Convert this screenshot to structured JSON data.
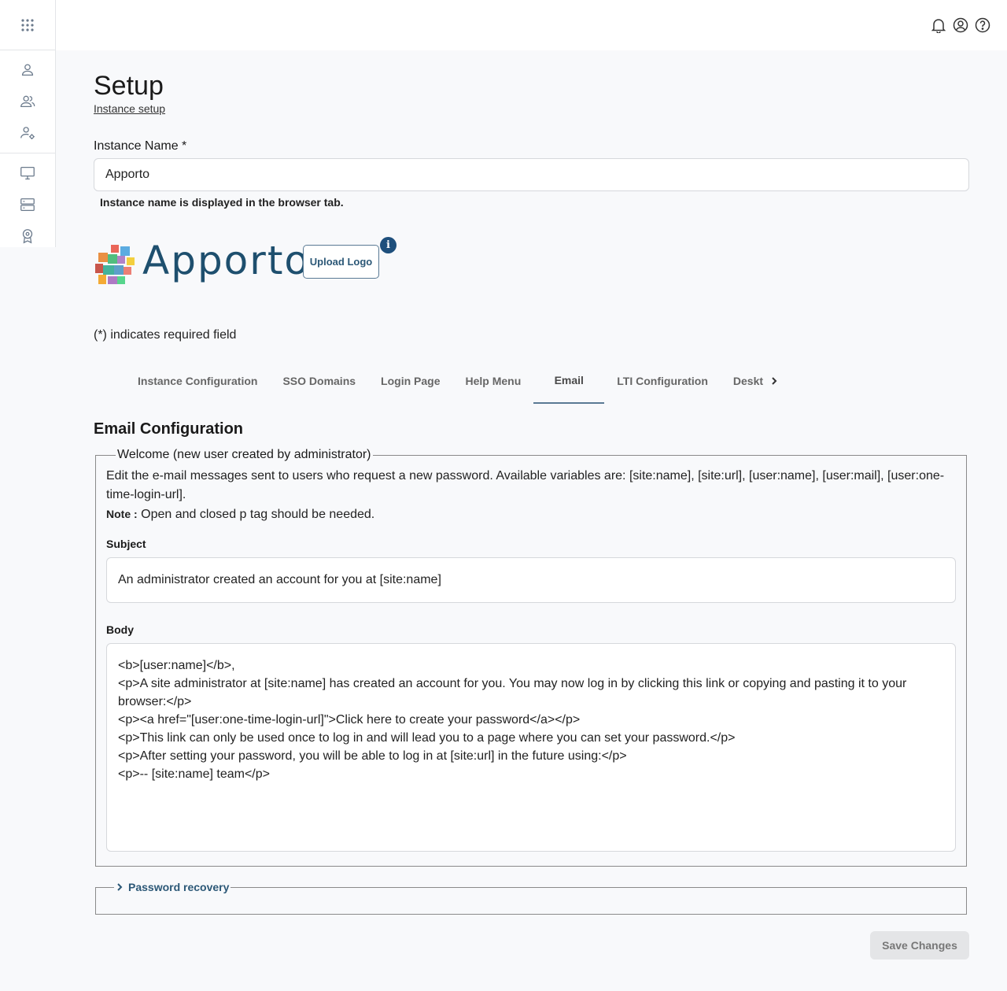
{
  "page": {
    "title": "Setup",
    "breadcrumb": "Instance setup"
  },
  "instance": {
    "label": "Instance Name *",
    "value": "Apporto",
    "helper": "Instance name is displayed in the browser tab."
  },
  "logo": {
    "text": "Apporto",
    "upload_label": "Upload Logo",
    "info_glyph": "i"
  },
  "required_note": "(*) indicates required field",
  "tabs": [
    {
      "label": "Instance Configuration"
    },
    {
      "label": "SSO Domains"
    },
    {
      "label": "Login Page"
    },
    {
      "label": "Help Menu"
    },
    {
      "label": "Email"
    },
    {
      "label": "LTI Configuration"
    },
    {
      "label": "Deskt"
    }
  ],
  "active_tab": "Email",
  "email": {
    "section_title": "Email Configuration",
    "welcome": {
      "legend": "Welcome (new user created by administrator)",
      "description": "Edit the e-mail messages sent to users who request a new password. Available variables are: [site:name], [site:url], [user:name], [user:mail], [user:one-time-login-url].",
      "note_label": "Note :",
      "note_text": " Open and closed p tag should be needed.",
      "subject_label": "Subject",
      "subject_value": "An administrator created an account for you at [site:name]",
      "body_label": "Body",
      "body_value": "<b>[user:name]</b>,\n<p>A site administrator at [site:name] has created an account for you. You may now log in by clicking this link or copying and pasting it to your browser:</p>\n<p><a href=\"[user:one-time-login-url]\">Click here to create your password</a></p>\n<p>This link can only be used once to log in and will lead you to a page where you can set your password.</p>\n<p>After setting your password, you will be able to log in at [site:url] in the future using:</p>\n<p>-- [site:name] team</p>"
    },
    "password_recovery": {
      "legend": "Password recovery"
    }
  },
  "save_label": "Save Changes",
  "colors": {
    "brand": "#1e4f6e",
    "accent": "#2c5877",
    "background": "#f8f9fb"
  },
  "icons": {
    "sidebar_top": "apps-grid-icon",
    "sidebar": [
      "user-icon",
      "users-icon",
      "user-settings-icon",
      "monitor-icon",
      "server-icon",
      "badge-icon"
    ],
    "topbar": [
      "bell-icon",
      "account-circle-icon",
      "help-circle-icon"
    ]
  }
}
